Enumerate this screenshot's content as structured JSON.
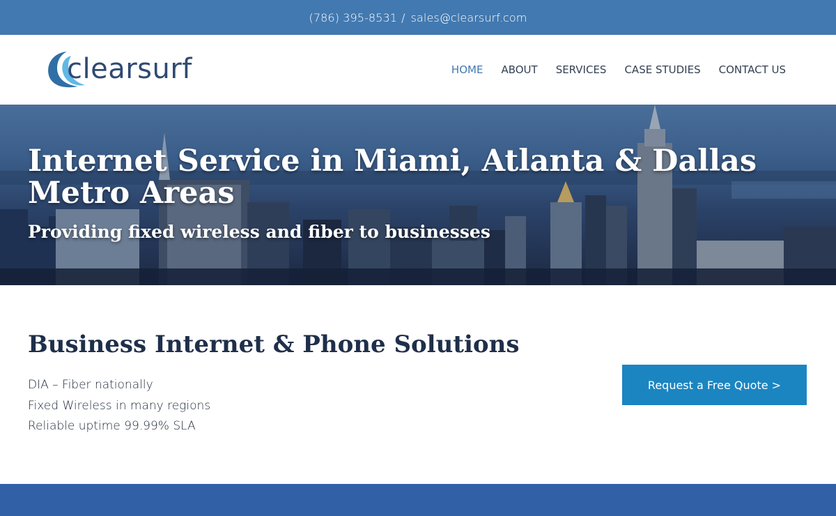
{
  "topbar": {
    "phone": "(786) 395-8531",
    "separator": "/",
    "email": "sales@clearsurf.com"
  },
  "header": {
    "logo_text": "clearsurf",
    "nav": [
      {
        "label": "HOME",
        "active": true
      },
      {
        "label": "ABOUT",
        "active": false
      },
      {
        "label": "SERVICES",
        "active": false
      },
      {
        "label": "CASE STUDIES",
        "active": false
      },
      {
        "label": "CONTACT US",
        "active": false
      }
    ]
  },
  "hero": {
    "title": "Internet Service in Miami, Atlanta & Dallas Metro Areas",
    "subtitle": "Providing fixed wireless and fiber to businesses"
  },
  "main": {
    "heading": "Business Internet & Phone Solutions",
    "features": [
      "DIA – Fiber nationally",
      "Fixed Wireless in many regions",
      "Reliable uptime 99.99% SLA"
    ],
    "cta_label": "Request a Free Quote >"
  },
  "colors": {
    "topbar": "#4279b0",
    "nav_active": "#4279b0",
    "cta": "#1b85c1",
    "footer_band": "#3160a6"
  }
}
